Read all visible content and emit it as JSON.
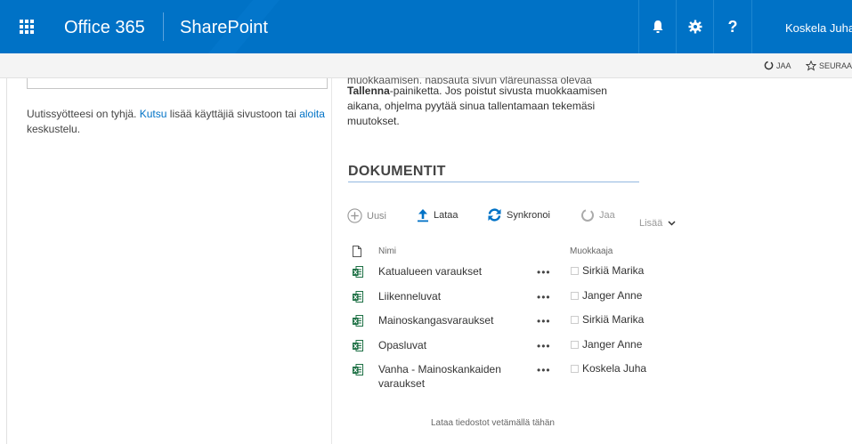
{
  "suitebar": {
    "app_name": "Office 365",
    "site_name": "SharePoint",
    "bell_label": "notifications",
    "user_name": "Koskela Juha"
  },
  "ribbon": {
    "share_label": "JAA",
    "follow_label": "SEURAA"
  },
  "newsfeed": {
    "empty_text": "Uutissyötteesi on tyhjä.",
    "invite_link": "Kutsu",
    "middle_text": "lisää käyttäjiä sivustoon tai",
    "start_link": "aloita",
    "end_text": "keskustelu."
  },
  "edit_info": {
    "clipped_line": "muokkaamisen, napsauta sivun yläreunassa olevaa",
    "bold_word": "Tallenna",
    "rest_text": "-painiketta. Jos poistut sivusta muokkaamisen aikana, ohjelma pyytää sinua tallentamaan tekemäsi muutokset."
  },
  "documents": {
    "title": "DOKUMENTIT",
    "toolbar": {
      "new_label": "Uusi",
      "upload_label": "Lataa",
      "sync_label": "Synkronoi",
      "share_label": "Jaa",
      "more_label": "Lisää"
    },
    "columns": {
      "name": "Nimi",
      "modified_by": "Muokkaaja"
    },
    "rows": [
      {
        "name": "Katualueen varaukset",
        "modified_by": "Sirkiä Marika"
      },
      {
        "name": "Liikenneluvat",
        "modified_by": "Janger Anne"
      },
      {
        "name": "Mainoskangasvaraukset",
        "modified_by": "Sirkiä Marika"
      },
      {
        "name": "Opasluvat",
        "modified_by": "Janger Anne"
      },
      {
        "name": "Vanha - Mainoskankaiden varaukset",
        "modified_by": "Koskela Juha"
      }
    ],
    "ellipsis": "•••",
    "drop_hint": "Lataa tiedostot vetämällä tähän"
  },
  "colors": {
    "suitebar": "#0072c6",
    "link": "#0072c6",
    "excel": "#1d7044"
  }
}
